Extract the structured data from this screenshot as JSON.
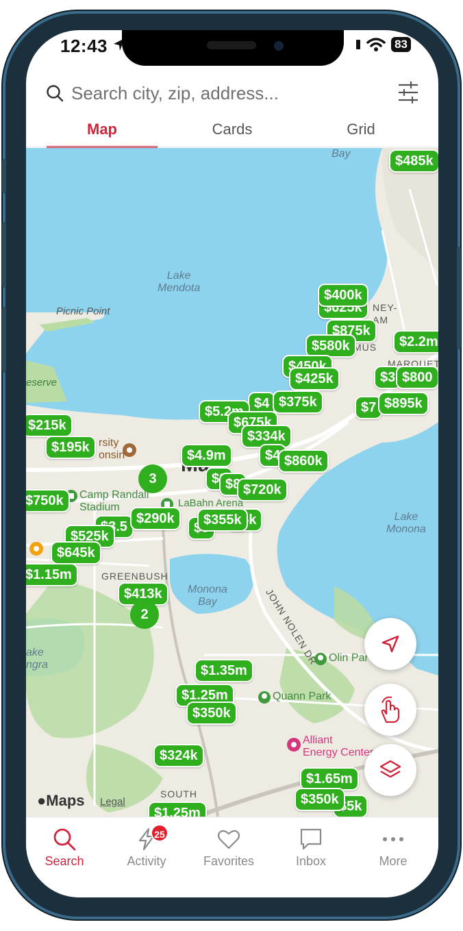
{
  "status": {
    "time": "12:43",
    "battery": "83"
  },
  "search": {
    "placeholder": "Search city, zip, address..."
  },
  "tabs": [
    {
      "label": "Map"
    },
    {
      "label": "Cards"
    },
    {
      "label": "Grid"
    }
  ],
  "map": {
    "labels": {
      "lake_mendota": "Lake\nMendota",
      "picnic_point": "Picnic Point",
      "bay": "Bay",
      "reserve": "eserve",
      "lake_monona": "Lake\nMonona",
      "monona_bay": "Monona\nBay",
      "greenbush": "GREENBUSH",
      "john_nolen": "JOHN NOLEN DR",
      "camp_randall": "Camp Randall\nStadium",
      "labahn": "LaBahn Arena",
      "university": "rsity\nonsin",
      "olin_park": "Olin Par",
      "quann_park": "Quann Park",
      "alliant": "Alliant\nEnergy Center",
      "lake_wingra": "ake\nngra",
      "south": "SOUTH",
      "madison": "Ma",
      "tenney": "NEY-\nAM",
      "mus": "MUS",
      "marquette": "MARQUETTE"
    },
    "pins": [
      "$485k",
      "$400k",
      "$625k",
      "$875k",
      "$2.2m",
      "$580k",
      "$450k",
      "$425k",
      "$800",
      "$895k",
      "$375k",
      "$5.2m",
      "$675k",
      "$334k",
      "$215k",
      "$195k",
      "$4.9m",
      "$860k",
      "$720k",
      "$8",
      "$750k",
      "$290k",
      "$355k",
      "$3.5",
      "$525k",
      "$645k",
      "$1.15m",
      "$413k",
      "$1.35m",
      "$1.25m",
      "$350k",
      "$324k",
      "$1.65m",
      "$350k",
      "$1.25m",
      "$4",
      "$3",
      "$5k",
      "$7"
    ],
    "clusters": [
      "3",
      "2"
    ],
    "attribution": "Maps",
    "legal": "Legal"
  },
  "nav": {
    "items": [
      {
        "label": "Search"
      },
      {
        "label": "Activity",
        "badge": "25"
      },
      {
        "label": "Favorites"
      },
      {
        "label": "Inbox"
      },
      {
        "label": "More"
      }
    ]
  },
  "colors": {
    "accent": "#d1243b",
    "pin": "#2fae1e",
    "water": "#8ed3ee",
    "park": "#b9dca4"
  }
}
